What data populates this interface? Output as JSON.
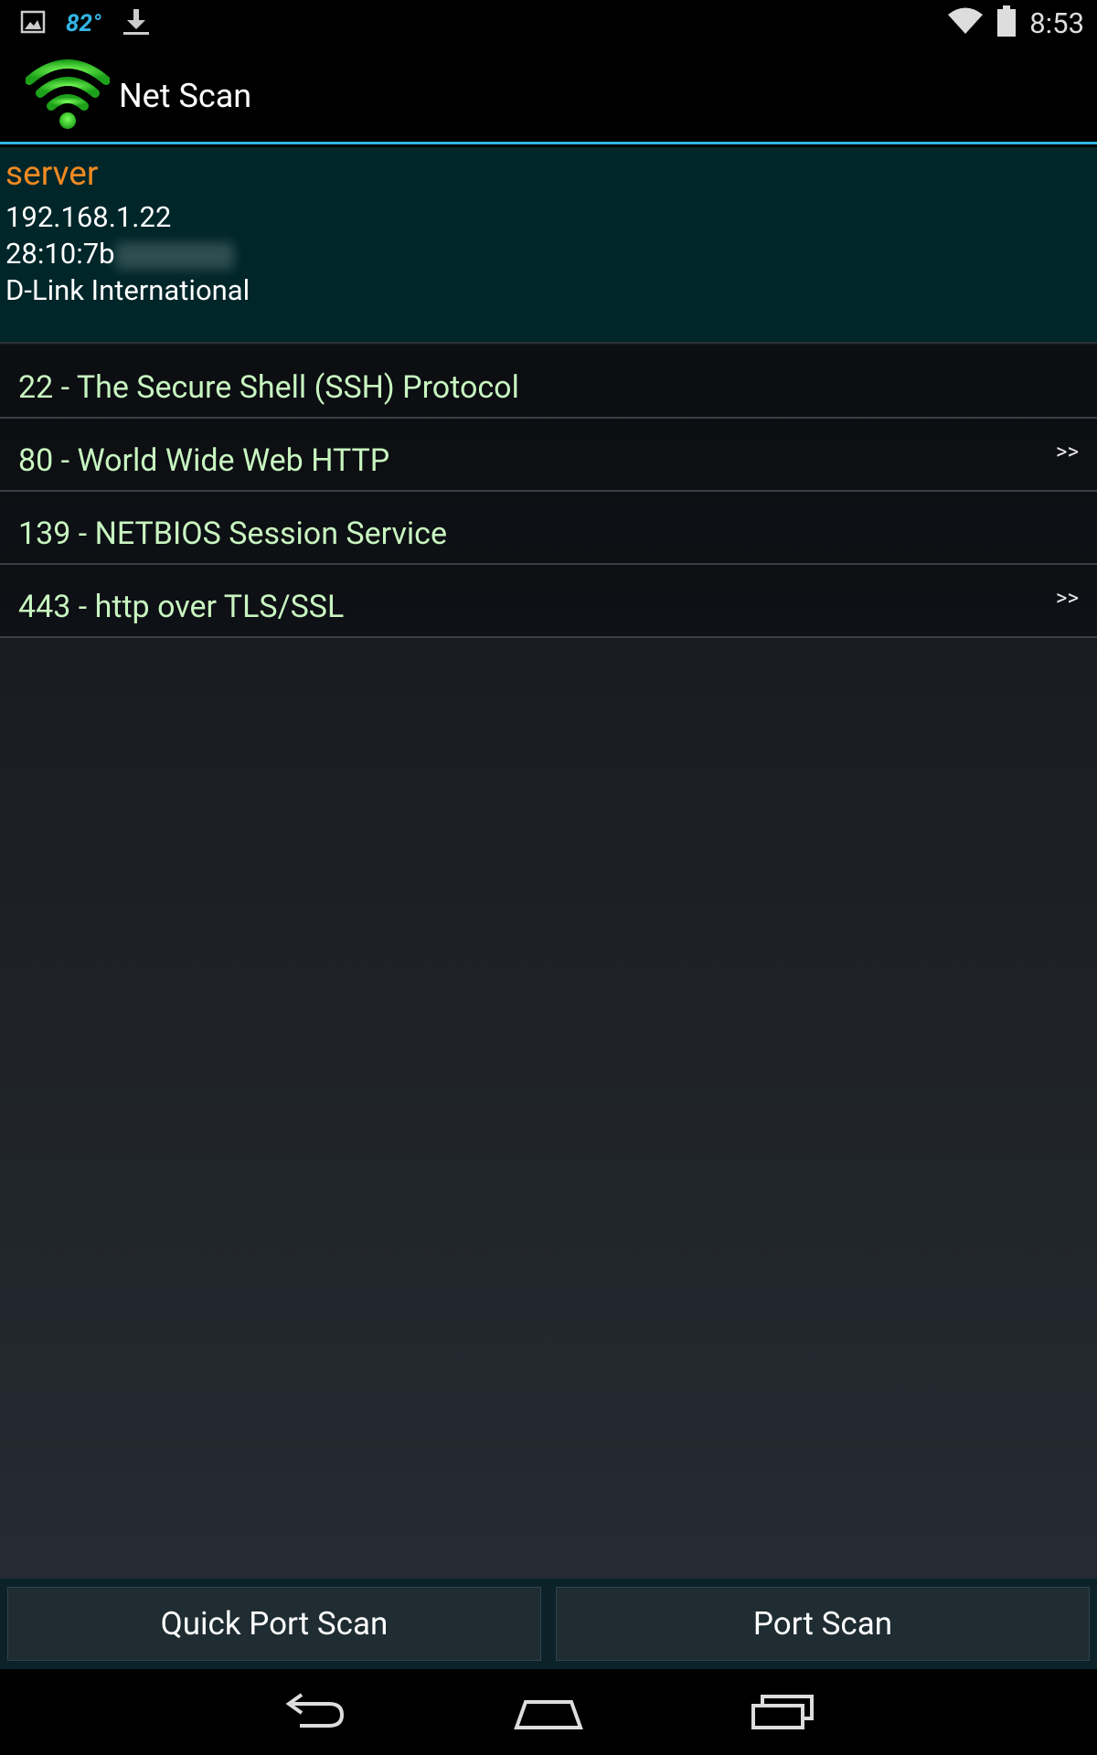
{
  "status_bar": {
    "temperature": "82°",
    "time": "8:53",
    "icons": [
      "gallery-icon",
      "download-icon",
      "wifi-icon",
      "battery-icon"
    ]
  },
  "action_bar": {
    "title": "Net Scan",
    "icon": "wifi-signal-icon",
    "accent_color": "#33b5e5"
  },
  "host": {
    "name": "server",
    "ip": "192.168.1.22",
    "mac_visible": "28:10:7b",
    "vendor": "D-Link International",
    "name_color": "#f08a22"
  },
  "ports": [
    {
      "label": "22 - The Secure Shell (SSH) Protocol",
      "arrow": ""
    },
    {
      "label": "80 - World Wide Web HTTP",
      "arrow": ">>"
    },
    {
      "label": "139 - NETBIOS Session Service",
      "arrow": ""
    },
    {
      "label": "443 - http over TLS/SSL",
      "arrow": ">>"
    }
  ],
  "buttons": {
    "quick_port_scan": "Quick Port Scan",
    "port_scan": "Port Scan"
  },
  "nav_bar": {
    "icons": [
      "back-icon",
      "home-icon",
      "recent-apps-icon"
    ]
  }
}
